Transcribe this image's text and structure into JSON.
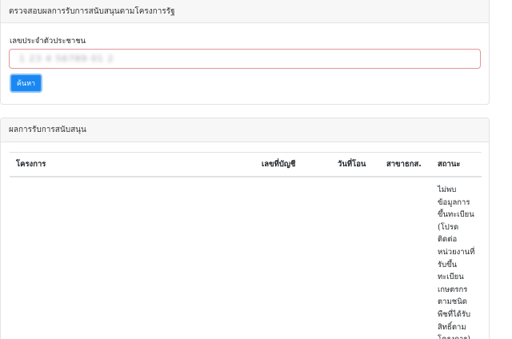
{
  "lookup": {
    "header": "ตรวจสอบผลการรับการสนับสนุนตามโครงการรัฐ",
    "id_label": "เลขประจำตัวประชาชน",
    "id_value": "1 23 4 56789 01 2",
    "search_button": "ค้นหา"
  },
  "results": {
    "header": "ผลการรับการสนับสนุน",
    "columns": [
      "โครงการ",
      "เลขที่บัญชี",
      "วันที่โอน",
      "สาขาธกส.",
      "สถานะ"
    ],
    "rows": [
      {
        "project": "",
        "account": "",
        "transfer_date": "",
        "branch": "",
        "status": "ไม่พบ\nข้อมูลการ\nขึ้นทะเบียน\n(โปรด\nติดต่อ\nหน่วยงานที่\nรับขึ้น\nทะเบียน\nเกษตรกร\nตามชนิด\nพืชที่ได้รับ\nสิทธิ์ตาม\nโครงการ)"
      }
    ]
  }
}
